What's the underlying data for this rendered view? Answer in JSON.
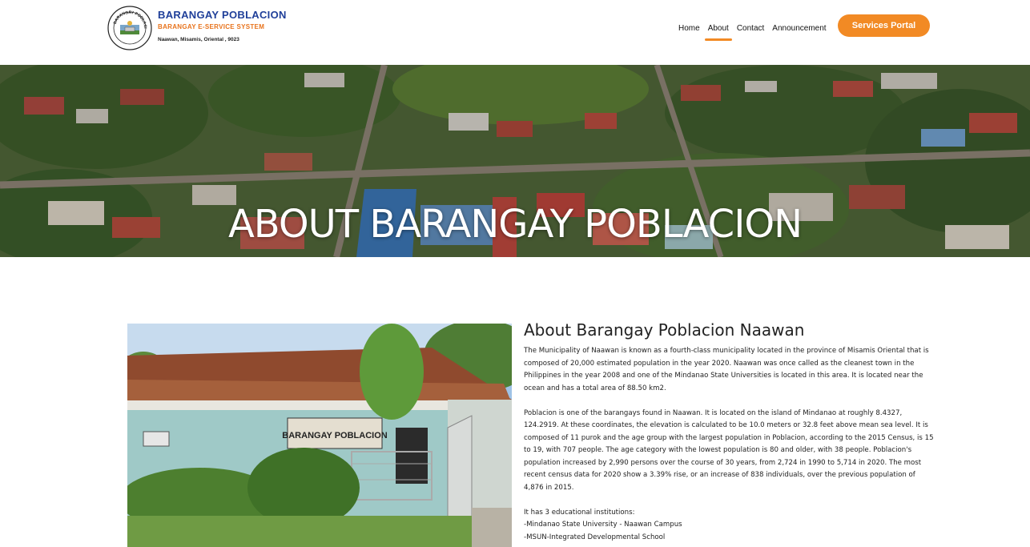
{
  "brand": {
    "name": "BARANGAY POBLACION",
    "subtitle": "BARANGAY E-SERVICE SYSTEM",
    "address": "Naawan, Misamis, Oriental , 9023",
    "seal_text": "BARANGAY POBLACION"
  },
  "nav": {
    "items": [
      {
        "label": "Home"
      },
      {
        "label": "About"
      },
      {
        "label": "Contact"
      },
      {
        "label": "Announcement"
      }
    ],
    "portal_label": "Services Portal"
  },
  "hero": {
    "title": "ABOUT BARANGAY POBLACION"
  },
  "about": {
    "title": "About Barangay Poblacion Naawan",
    "paragraph_1": "The Municipality of Naawan is known as a fourth-class municipality located in the province of Misamis Oriental that is composed of 20,000 estimated population in the year 2020. Naawan was once called as the cleanest town in the Philippines in the year 2008 and one of the Mindanao State Universities is located in this area. It is located near the ocean and has a total area of 88.50 km2.",
    "paragraph_2": "Poblacion is one of the barangays found in Naawan. It is located on the island of Mindanao at roughly 8.4327, 124.2919. At these coordinates, the elevation is calculated to be 10.0 meters or 32.8 feet above mean sea level. It is composed of 11 purok and the age group with the largest population in Poblacion, according to the 2015 Census, is 15 to 19, with 707 people. The age category with the lowest population is 80 and older, with 38 people. Poblacion's population increased by 2,990 persons over the course of 30 years, from 2,724 in 1990 to 5,714 in 2020. The most recent census data for 2020 show a 3.39% rise, or an increase of 838 individuals, over the previous population of 4,876 in 2015.",
    "institutions_intro": "It has 3 educational institutions:",
    "institutions": [
      "-Mindanao State University - Naawan Campus",
      "-MSUN-Integrated Developmental School"
    ]
  },
  "photo": {
    "sign_text": "BARANGAY POBLACION"
  },
  "colors": {
    "brand_blue": "#1f3f99",
    "accent_orange": "#f28a24",
    "subtitle_orange": "#e8731c"
  }
}
